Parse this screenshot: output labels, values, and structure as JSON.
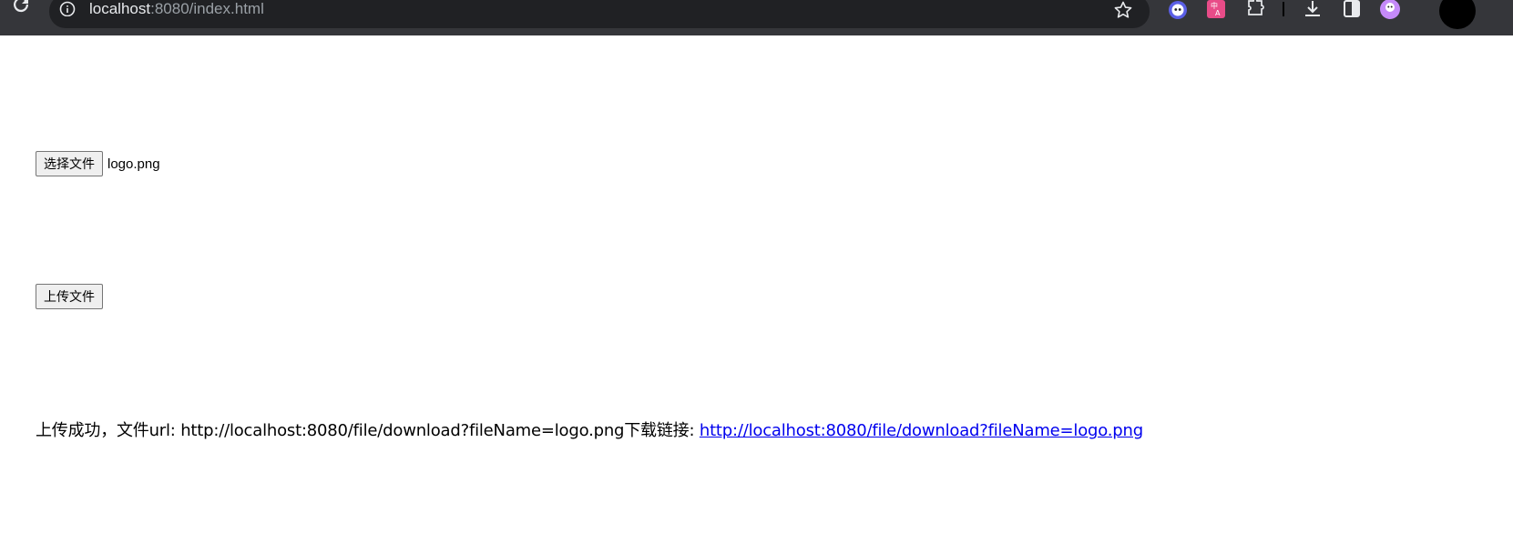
{
  "browser": {
    "url_host": "localhost",
    "url_rest": ":8080/index.html",
    "icons": [
      "reload-icon",
      "info-icon",
      "star-icon",
      "ghost-extension-icon",
      "translate-extension-icon",
      "puzzle-extension-icon",
      "download-icon",
      "side-panel-icon",
      "profile-avatar-icon"
    ]
  },
  "page": {
    "choose_file_label": "选择文件",
    "chosen_file_name": "logo.png",
    "upload_label": "上传文件",
    "result_prefix": "上传成功，文件url: http://localhost:8080/file/download?fileName=logo.png下载链接: ",
    "download_link_text": "http://localhost:8080/file/download?fileName=logo.png"
  },
  "colors": {
    "chrome_bg": "#35363a",
    "omnibox_bg": "#202124",
    "link": "#0000ee"
  }
}
